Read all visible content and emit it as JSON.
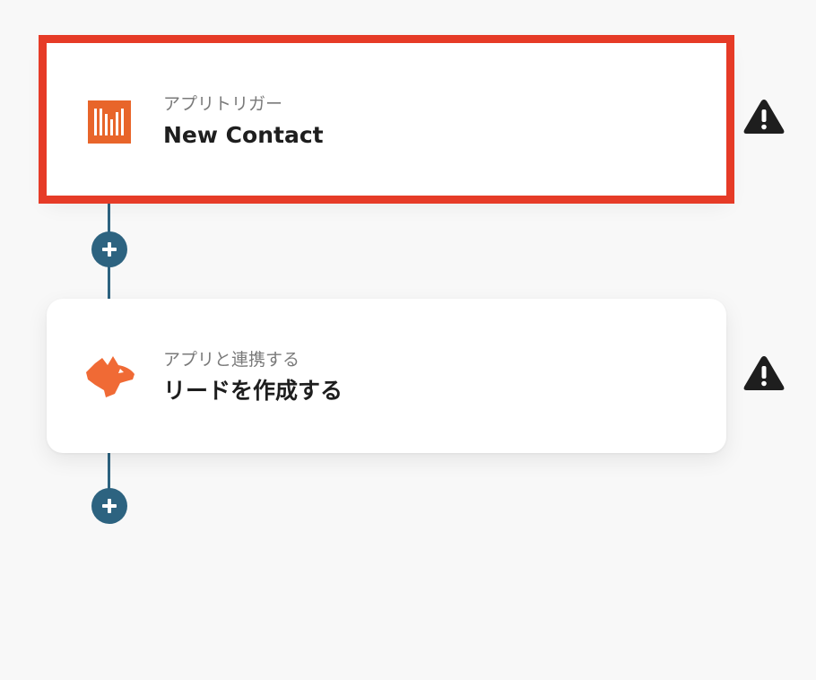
{
  "flow": {
    "steps": [
      {
        "type_label": "アプリトリガー",
        "title": "New Contact",
        "app_icon": "bar-logo-icon",
        "selected": true,
        "warning_icon": "warning-icon"
      },
      {
        "type_label": "アプリと連携する",
        "title": "リードを作成する",
        "app_icon": "fox-logo-icon",
        "selected": false,
        "warning_icon": "warning-icon"
      }
    ],
    "add_step_icon": "plus-icon"
  },
  "colors": {
    "background": "#f8f8f8",
    "connector": "#2d6380",
    "selection_border": "#e63b27",
    "app1_brand": "#e8652a",
    "app2_brand": "#f06a35",
    "warning": "#1e1e1e"
  }
}
